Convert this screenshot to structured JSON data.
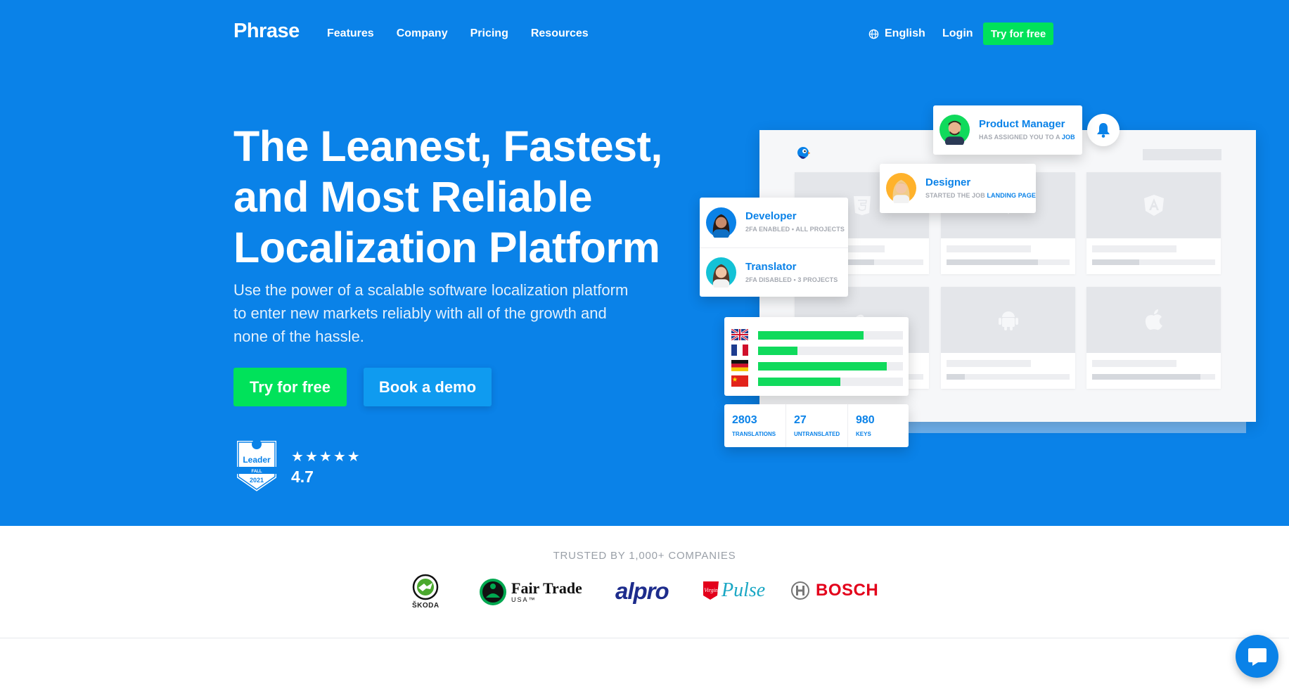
{
  "nav": {
    "logo": "Phrase",
    "links": [
      "Features",
      "Company",
      "Pricing",
      "Resources"
    ],
    "language": "English",
    "login": "Login",
    "cta": "Try for free"
  },
  "hero": {
    "headline_lines": [
      "The Leanest, Fastest,",
      "and Most Reliable",
      "Localization Platform"
    ],
    "subhead_lines": [
      "Use the power of a scalable software localization platform",
      "to enter new markets reliably with all of the growth and",
      "none of the hassle."
    ],
    "primary_button": "Try for free",
    "secondary_button": "Book a demo",
    "badge": {
      "title": "Leader",
      "season": "FALL",
      "year": "2021",
      "brand_letter": "G"
    },
    "rating": "4.7",
    "stars": 5
  },
  "illustration": {
    "product_manager": {
      "role": "Product Manager",
      "desc": "HAS ASSIGNED YOU TO A",
      "highlight": "JOB"
    },
    "designer": {
      "role": "Designer",
      "desc": "STARTED THE JOB",
      "highlight": "LANDING PAGE"
    },
    "developer": {
      "role": "Developer",
      "desc": "2FA ENABLED • ALL PROJECTS"
    },
    "translator": {
      "role": "Translator",
      "desc": "2FA DISABLED • 3 PROJECTS"
    },
    "languages": [
      {
        "flag": "uk-flag",
        "progress": 0.73
      },
      {
        "flag": "france-flag",
        "progress": 0.27
      },
      {
        "flag": "germany-flag",
        "progress": 0.89
      },
      {
        "flag": "china-flag",
        "progress": 0.57
      }
    ],
    "stats": [
      {
        "value": "2803",
        "label": "TRANSLATIONS"
      },
      {
        "value": "27",
        "label": "UNTRANSLATED"
      },
      {
        "value": "980",
        "label": "KEYS"
      }
    ],
    "tile_icons": [
      "html5-icon",
      "vue-icon",
      "angular-icon",
      "ember-icon",
      "android-icon",
      "apple-icon"
    ]
  },
  "trusted": {
    "heading": "TRUSTED BY 1,000+ COMPANIES",
    "skoda": "ŠKODA",
    "fairtrade_name": "Fair Trade",
    "fairtrade_sub": "USA™",
    "alpro": "alpro",
    "virgin": "Pulse",
    "virgin_small": "Virgin",
    "bosch": "BOSCH"
  },
  "colors": {
    "brand_blue": "#0A82E8",
    "accent_green": "#00E25A",
    "secondary_blue": "#0F9BF0"
  }
}
